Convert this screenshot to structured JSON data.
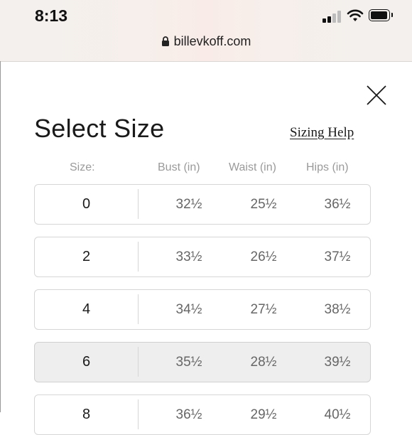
{
  "status_bar": {
    "time": "8:13"
  },
  "browser": {
    "url": "billevkoff.com"
  },
  "modal": {
    "title": "Select Size",
    "help_link": "Sizing Help",
    "columns": {
      "size": "Size:",
      "bust": "Bust (in)",
      "waist": "Waist (in)",
      "hips": "Hips (in)"
    },
    "rows": [
      {
        "size": "0",
        "bust": "32½",
        "waist": "25½",
        "hips": "36½",
        "selected": false
      },
      {
        "size": "2",
        "bust": "33½",
        "waist": "26½",
        "hips": "37½",
        "selected": false
      },
      {
        "size": "4",
        "bust": "34½",
        "waist": "27½",
        "hips": "38½",
        "selected": false
      },
      {
        "size": "6",
        "bust": "35½",
        "waist": "28½",
        "hips": "39½",
        "selected": true
      },
      {
        "size": "8",
        "bust": "36½",
        "waist": "29½",
        "hips": "40½",
        "selected": false
      }
    ]
  },
  "colors": {
    "selected_row_bg": "#eeeeee",
    "row_border": "#d6d6d6",
    "header_text": "#9a9a9a",
    "value_text": "#666666"
  },
  "icons": [
    "lock-icon",
    "close-icon",
    "signal-icon",
    "wifi-icon",
    "battery-icon"
  ]
}
